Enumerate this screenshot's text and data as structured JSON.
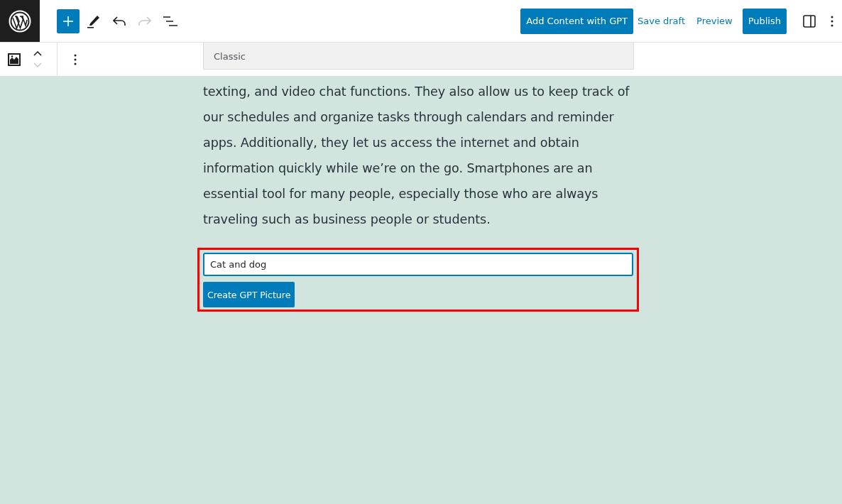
{
  "header_toolbar": {
    "tools": [
      {
        "kind": "add",
        "disabled": false
      },
      {
        "kind": "pen",
        "disabled": false
      },
      {
        "kind": "undo",
        "disabled": false
      },
      {
        "kind": "redo",
        "disabled": true
      },
      {
        "kind": "outline",
        "disabled": false
      }
    ]
  },
  "actions": [
    {
      "kind": "primary",
      "label": "Add Content with GPT"
    },
    {
      "kind": "link",
      "label": "Save draft"
    },
    {
      "kind": "link",
      "label": "Preview"
    },
    {
      "kind": "primary",
      "label": "Publish"
    }
  ],
  "block_toolbar": {
    "move_up": {
      "disabled": false
    },
    "move_down": {
      "disabled": true
    }
  },
  "classic_block": {
    "label": "Classic"
  },
  "paragraph": "texting, and video chat functions. They also allow us to keep track of our schedules and organize tasks through calendars and reminder apps. Additionally, they let us access the internet and obtain information quickly while we’re on the go. Smartphones are an essential tool for many people, especially those who are always traveling such as business people or students.",
  "gpt_picture": {
    "prompt": {
      "value": "Cat and dog"
    },
    "button": "Create GPT Picture"
  }
}
